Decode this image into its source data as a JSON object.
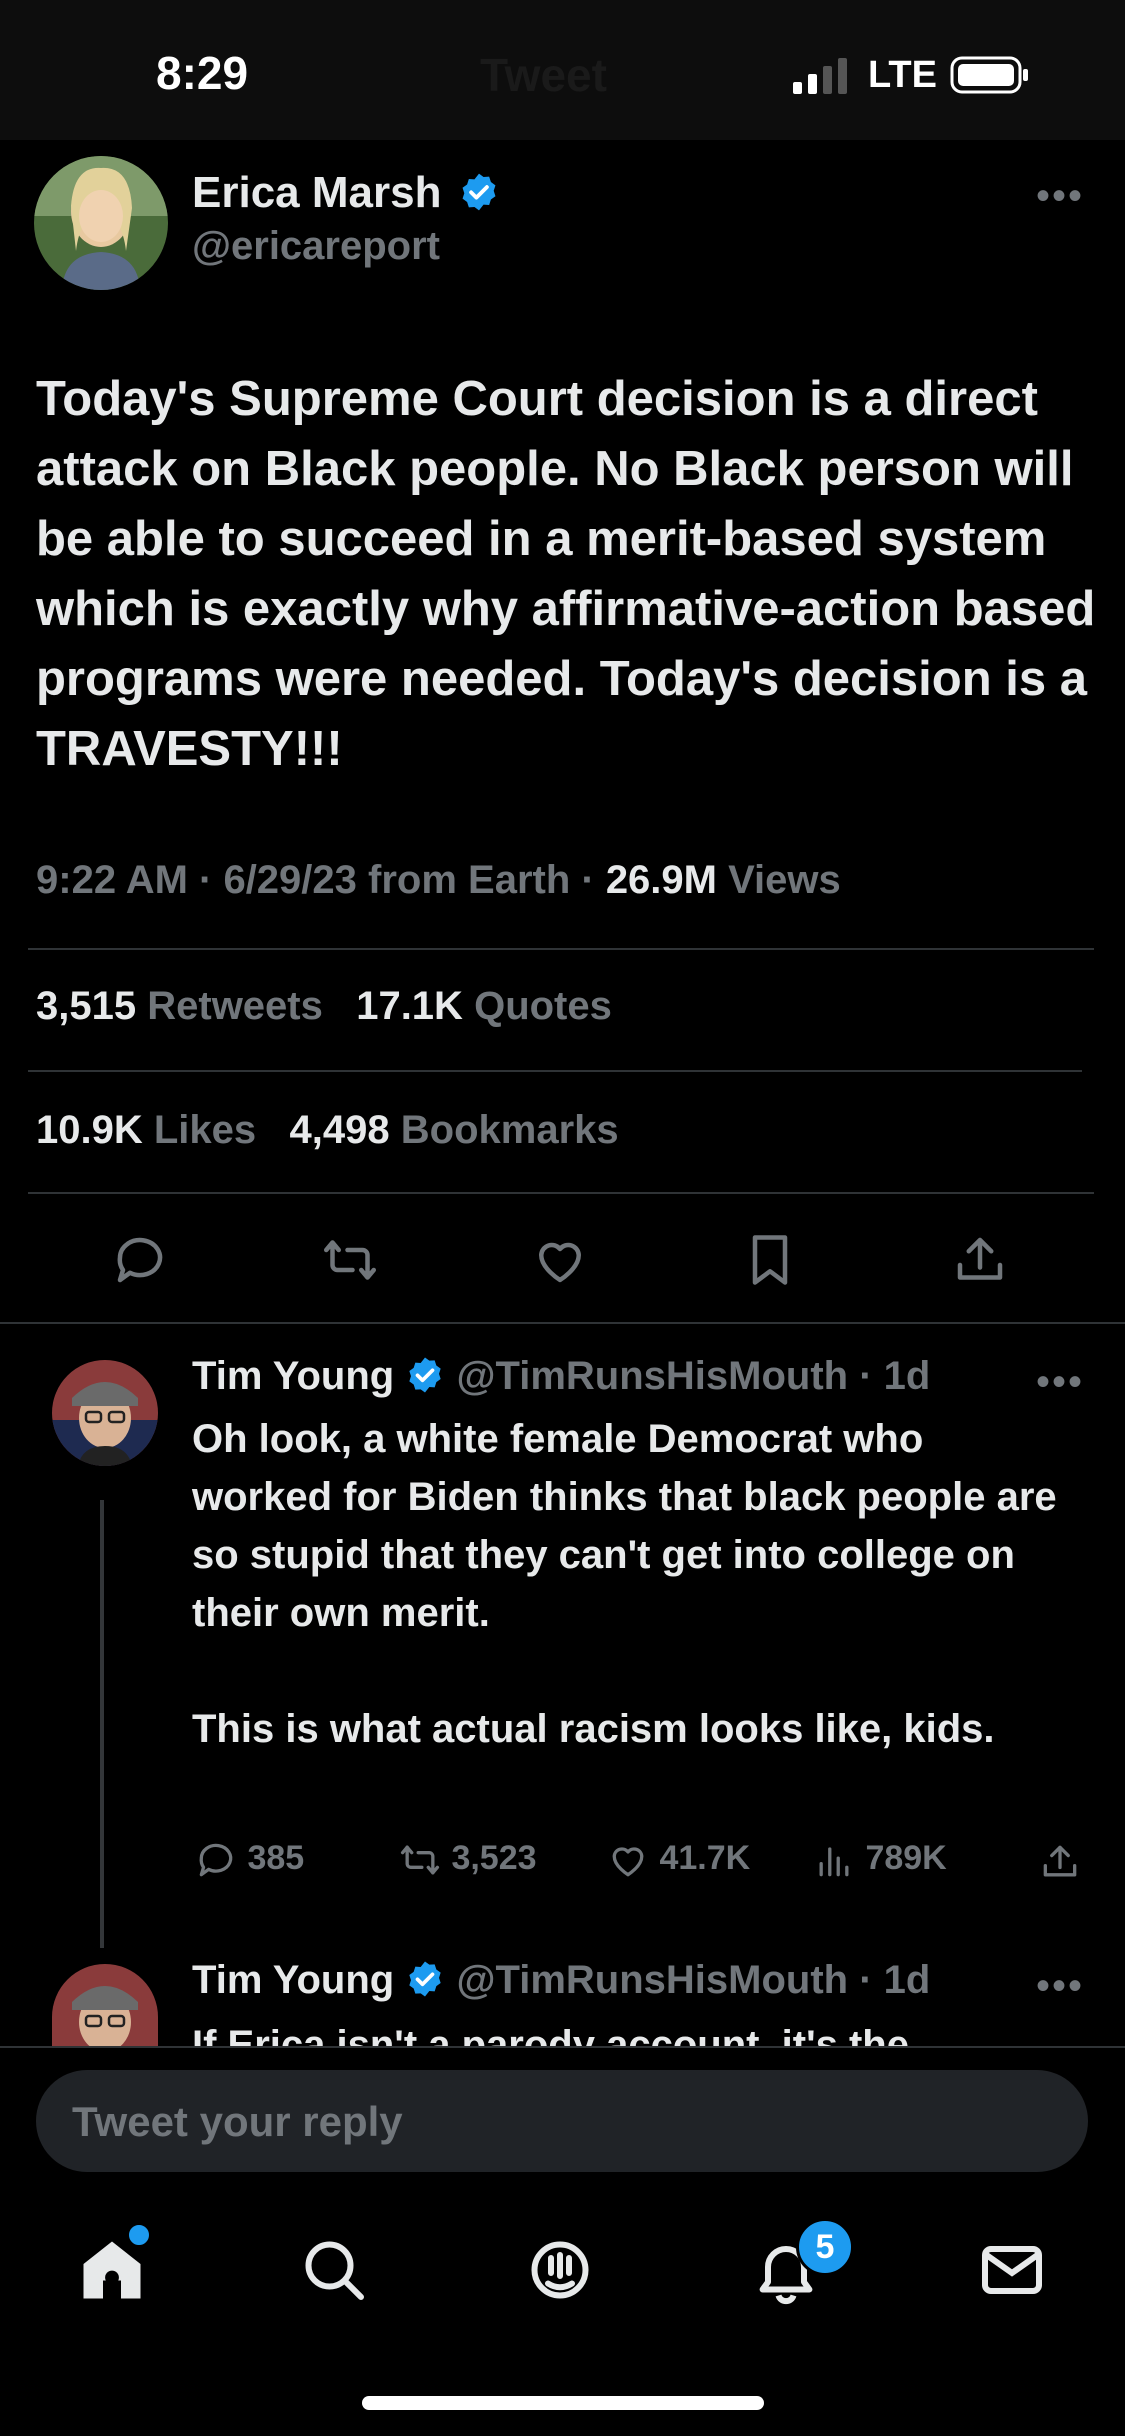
{
  "status_bar": {
    "time": "8:29",
    "network": "LTE",
    "ghost_title": "Tweet"
  },
  "tweet": {
    "author_name": "Erica Marsh",
    "author_handle": "@ericareport",
    "text": "Today's Supreme Court decision is a direct attack on Black people. No Black person will be able to succeed in a merit-based system which is exactly why affirmative-action based programs were needed. Today's decision is a TRAVESTY!!!",
    "timestamp": "9:22 AM · 6/29/23 from Earth · ",
    "views_count": "26.9M",
    "views_label": " Views",
    "retweets_count": "3,515",
    "retweets_label": "Retweets",
    "quotes_count": "17.1K",
    "quotes_label": "Quotes",
    "likes_count": "10.9K",
    "likes_label": "Likes",
    "bookmarks_count": "4,498",
    "bookmarks_label": "Bookmarks",
    "actions": [
      "reply-icon",
      "retweet-icon",
      "like-icon",
      "bookmark-icon",
      "share-icon"
    ]
  },
  "replies": [
    {
      "name": "Tim Young",
      "handle": "@TimRunsHisMouth",
      "age": " · 1d",
      "text_p1": "Oh look, a white female Democrat who worked for Biden thinks that black people are so stupid that they can't get into college on their own merit.",
      "text_p2": "This is what actual racism looks like, kids.",
      "reply_count": "385",
      "retweet_count": "3,523",
      "like_count": "41.7K",
      "view_count": "789K"
    },
    {
      "name": "Tim Young",
      "handle": "@TimRunsHisMouth",
      "age": " · 1d",
      "text_partial": "If Erica isn't a parody account, it's the"
    }
  ],
  "reply_box": {
    "placeholder": "Tweet your reply"
  },
  "bottom_nav": {
    "notifications_badge": "5"
  },
  "colors": {
    "background": "#000000",
    "text": "#e7e9ea",
    "muted": "#71767b",
    "accent": "#1d9bf0",
    "divider": "#2f3336"
  }
}
